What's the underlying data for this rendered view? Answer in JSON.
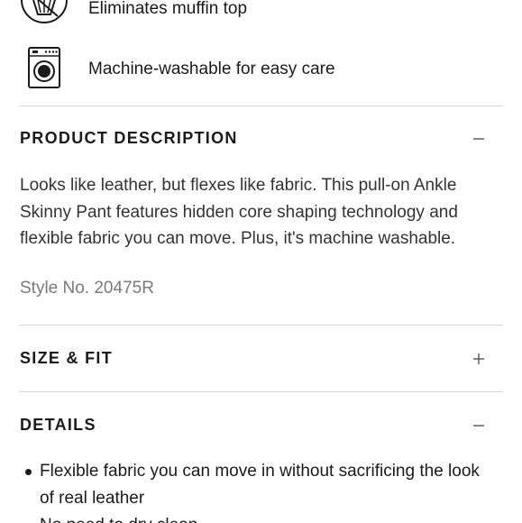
{
  "features": [
    {
      "icon": "muffin-top-icon",
      "label": "Eliminates muffin top"
    },
    {
      "icon": "washing-machine-icon",
      "label": "Machine-washable for easy care"
    }
  ],
  "sections": {
    "description": {
      "title": "PRODUCT DESCRIPTION",
      "expanded": true,
      "body": "Looks like leather, but flexes like fabric. This pull-on Ankle Skinny Pant features hidden core shaping technology and flexible fabric you can move. Plus, it's machine washable.",
      "style_no": "Style No. 20475R"
    },
    "size_fit": {
      "title": "SIZE & FIT",
      "expanded": false
    },
    "details": {
      "title": "DETAILS",
      "expanded": true,
      "bullets": [
        "Flexible fabric you can move in without sacrificing the look of real leather",
        "No need to dry clean"
      ]
    }
  },
  "colors": {
    "text": "#1a1a1a",
    "muted": "#7a7a7a",
    "divider": "#d6d6d6"
  }
}
